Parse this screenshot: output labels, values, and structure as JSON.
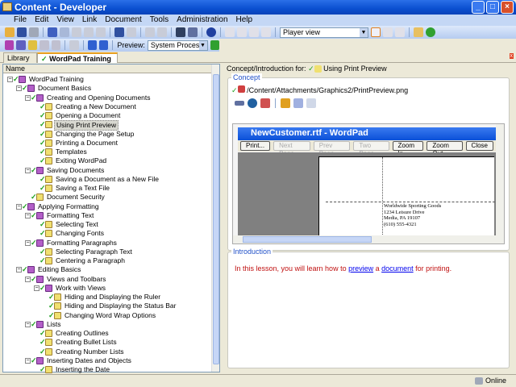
{
  "window": {
    "title": "Content - Developer"
  },
  "menu": [
    "File",
    "Edit",
    "View",
    "Link",
    "Document",
    "Tools",
    "Administration",
    "Help"
  ],
  "toolbar": {
    "preview_label": "Preview:",
    "preview_value": "System Process",
    "view_value": "Player view"
  },
  "tabs": [
    {
      "label": "Library"
    },
    {
      "label": "WordPad Training"
    }
  ],
  "tree": {
    "column_header": "Name",
    "items": [
      {
        "label": "WordPad Training",
        "level": 0,
        "type": "folder"
      },
      {
        "label": "Document Basics",
        "level": 1,
        "type": "folder"
      },
      {
        "label": "Creating and Opening Documents",
        "level": 2,
        "type": "folder"
      },
      {
        "label": "Creating a New Document",
        "level": 3,
        "type": "doc"
      },
      {
        "label": "Opening a Document",
        "level": 3,
        "type": "doc"
      },
      {
        "label": "Using Print Preview",
        "level": 3,
        "type": "doc",
        "selected": true
      },
      {
        "label": "Changing the Page Setup",
        "level": 3,
        "type": "doc"
      },
      {
        "label": "Printing a Document",
        "level": 3,
        "type": "doc"
      },
      {
        "label": "Templates",
        "level": 3,
        "type": "doc"
      },
      {
        "label": "Exiting WordPad",
        "level": 3,
        "type": "doc"
      },
      {
        "label": "Saving Documents",
        "level": 2,
        "type": "folder"
      },
      {
        "label": "Saving a Document as a New File",
        "level": 3,
        "type": "doc"
      },
      {
        "label": "Saving a Text File",
        "level": 3,
        "type": "doc"
      },
      {
        "label": "Document Security",
        "level": 2,
        "type": "doc"
      },
      {
        "label": "Applying Formatting",
        "level": 1,
        "type": "folder"
      },
      {
        "label": "Formatting Text",
        "level": 2,
        "type": "folder"
      },
      {
        "label": "Selecting Text",
        "level": 3,
        "type": "doc"
      },
      {
        "label": "Changing Fonts",
        "level": 3,
        "type": "doc"
      },
      {
        "label": "Formatting Paragraphs",
        "level": 2,
        "type": "folder"
      },
      {
        "label": "Selecting Paragraph Text",
        "level": 3,
        "type": "doc"
      },
      {
        "label": "Centering a Paragraph",
        "level": 3,
        "type": "doc"
      },
      {
        "label": "Editing Basics",
        "level": 1,
        "type": "folder"
      },
      {
        "label": "Views and Toolbars",
        "level": 2,
        "type": "folder"
      },
      {
        "label": "Work with Views",
        "level": 3,
        "type": "folder"
      },
      {
        "label": "Hiding and Displaying the Ruler",
        "level": 4,
        "type": "doc"
      },
      {
        "label": "Hiding and Displaying the Status Bar",
        "level": 4,
        "type": "doc"
      },
      {
        "label": "Changing Word Wrap Options",
        "level": 4,
        "type": "doc"
      },
      {
        "label": "Lists",
        "level": 2,
        "type": "folder"
      },
      {
        "label": "Creating Outlines",
        "level": 3,
        "type": "doc"
      },
      {
        "label": "Creating Bullet Lists",
        "level": 3,
        "type": "doc"
      },
      {
        "label": "Creating Number Lists",
        "level": 3,
        "type": "doc"
      },
      {
        "label": "Inserting Dates and Objects",
        "level": 2,
        "type": "folder"
      },
      {
        "label": "Inserting the Date",
        "level": 3,
        "type": "doc"
      }
    ]
  },
  "right": {
    "header_label": "Concept/Introduction for:",
    "header_item": "Using Print Preview",
    "concept": {
      "title": "Concept",
      "path": "/Content/Attachments/Graphics2/PrintPreview.png"
    },
    "preview": {
      "window_title": "NewCustomer.rtf - WordPad",
      "buttons": [
        {
          "label": "Print...",
          "enabled": true
        },
        {
          "label": "Next Page",
          "enabled": false
        },
        {
          "label": "Prev Page",
          "enabled": false
        },
        {
          "label": "Two Page",
          "enabled": false
        },
        {
          "label": "Zoom In",
          "enabled": true
        },
        {
          "label": "Zoom Out",
          "enabled": true
        },
        {
          "label": "Close",
          "enabled": true
        }
      ],
      "address": [
        "Worldwide Sporting Goods",
        "1234 Leisure Drive",
        "Media, PA 19107",
        "(610) 555-4321"
      ]
    },
    "introduction": {
      "title": "Introduction",
      "text_before": "In this lesson, you will learn how to ",
      "link1": "preview",
      "text_mid": " a ",
      "link2": "document",
      "text_after": " for printing."
    }
  },
  "status": {
    "online": "Online"
  }
}
